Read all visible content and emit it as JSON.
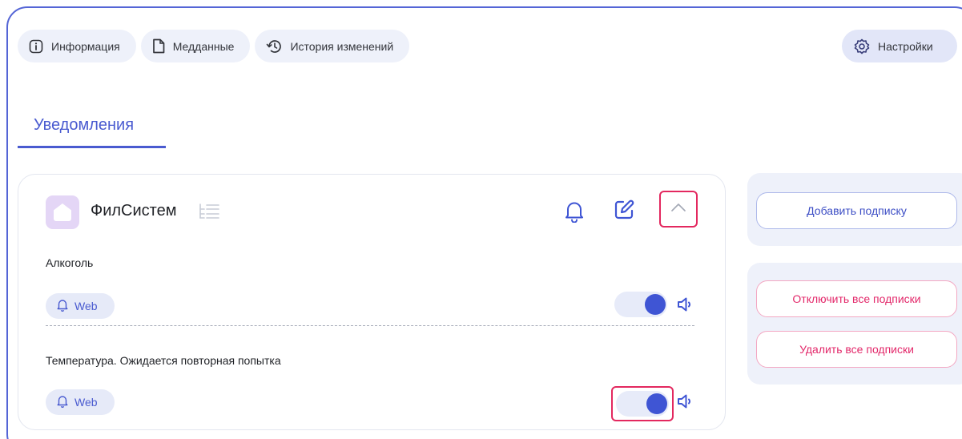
{
  "tabs": [
    {
      "label": "Информация",
      "icon": "info-icon"
    },
    {
      "label": "Медданные",
      "icon": "document-icon"
    },
    {
      "label": "История изменений",
      "icon": "history-icon"
    }
  ],
  "settings": {
    "label": "Настройки",
    "icon": "gear-icon"
  },
  "section_tab": {
    "label": "Уведомления"
  },
  "card": {
    "title": "ФилСистем",
    "subscriptions": [
      {
        "name": "Алкоголь",
        "channel": "Web",
        "enabled": true
      },
      {
        "name": "Температура. Ожидается повторная попытка",
        "channel": "Web",
        "enabled": true
      }
    ]
  },
  "actions": {
    "add": "Добавить подписку",
    "disable_all": "Отключить все подписки",
    "delete_all": "Удалить все подписки"
  },
  "colors": {
    "accent": "#4a5bd0",
    "danger": "#e3285f",
    "pill_bg": "#eef1fa",
    "logo_bg": "#e4d6f6"
  }
}
